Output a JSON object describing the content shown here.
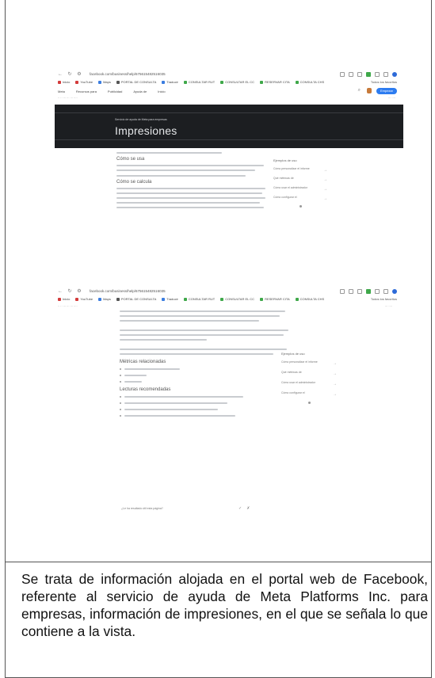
{
  "shot1": {
    "url": "facebook.com/business/help/675615482516035",
    "bookmarks": [
      "Inicio",
      "YouTube",
      "Maps",
      "PORTAL DE CONSULTA",
      "Traducir",
      "CONSULTAR RUT",
      "CONSULTAR EL CC",
      "RESERVAR CITA",
      "CONSULTA CHS"
    ],
    "bookmark_colors": [
      "#d33b3b",
      "#d33b3b",
      "#3b7de0",
      "#555555",
      "#3b7de0",
      "#3fa84a",
      "#3fa84a",
      "#3fa84a",
      "#3fa84a"
    ],
    "bookmarks_right": "Todos los favoritos",
    "nav": [
      "Meta",
      "Recursos para",
      "Publicidad",
      "Ayuda de",
      "Inicio"
    ],
    "nav_button": "Empezar",
    "hero_kicker": "Servicio de ayuda de Meta para empresas",
    "hero_title": "Impresiones",
    "section_heading_1": "Cómo se usa",
    "section_heading_2": "Cómo se calcula",
    "sidebar_heading": "Ejemplos de uso",
    "sidebar_items": [
      "Cómo personalizar el informe",
      "Qué métricas de",
      "Cómo usar el administrador",
      "Cómo configurar el"
    ]
  },
  "shot2": {
    "url": "facebook.com/business/help/675615482516035",
    "bookmarks": [
      "Inicio",
      "YouTube",
      "Maps",
      "PORTAL DE CONSULTA",
      "Traducir",
      "CONSULTAR RUT",
      "CONSULTAR EL CC",
      "RESERVAR CITA",
      "CONSULTA CHS"
    ],
    "bookmark_colors": [
      "#d33b3b",
      "#d33b3b",
      "#3b7de0",
      "#555555",
      "#3b7de0",
      "#3fa84a",
      "#3fa84a",
      "#3fa84a",
      "#3fa84a"
    ],
    "bookmarks_right": "Todos los favoritos",
    "section_heading_1": "Métricas relacionadas",
    "section_heading_2": "Lecturas recomendadas",
    "question": "¿Le ha resultado útil esta página?",
    "sidebar_heading": "Ejemplos de uso",
    "sidebar_items": [
      "Cómo personalizar el informe",
      "Qué métricas de",
      "Cómo usar el administrador",
      "Cómo configurar el"
    ]
  },
  "caption": "Se trata de información alojada en el portal web de Facebook, referente al servicio de ayuda de Meta Platforms Inc. para empresas, información de impresiones, en el que se señala lo que contiene a la vista."
}
